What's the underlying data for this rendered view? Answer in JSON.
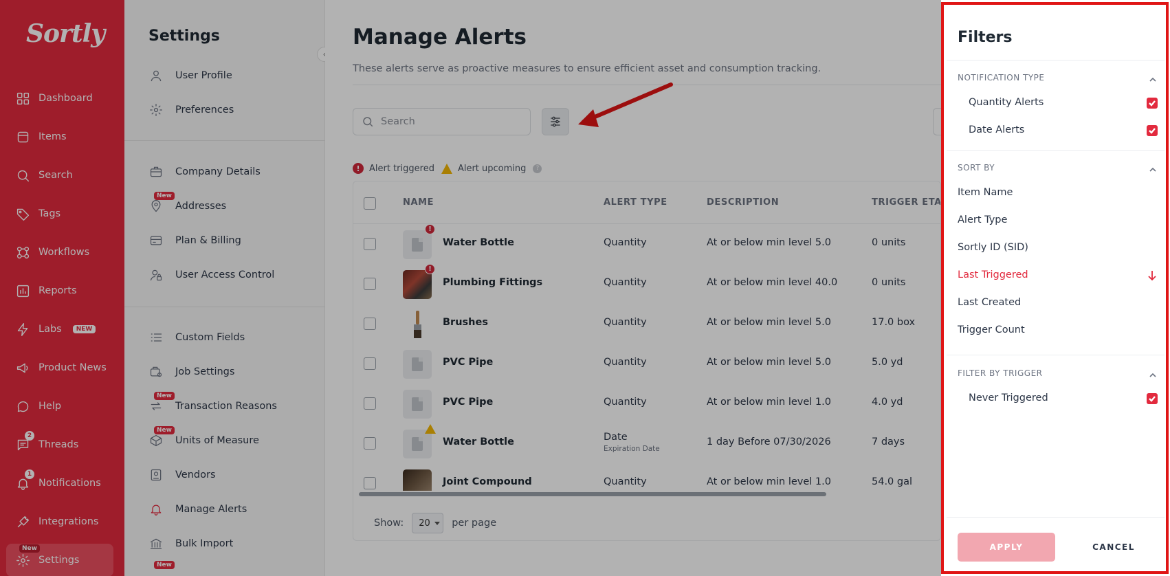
{
  "brand": {
    "logo_text": "Sortly",
    "accent_color": "#e22a3e"
  },
  "nav": {
    "items": [
      {
        "label": "Dashboard",
        "icon": "dashboard-icon"
      },
      {
        "label": "Items",
        "icon": "items-icon"
      },
      {
        "label": "Search",
        "icon": "search-icon"
      },
      {
        "label": "Tags",
        "icon": "tag-icon"
      },
      {
        "label": "Workflows",
        "icon": "workflows-icon"
      },
      {
        "label": "Reports",
        "icon": "reports-icon"
      },
      {
        "label": "Labs",
        "icon": "bolt-icon",
        "pill": "NEW"
      },
      {
        "label": "Product News",
        "icon": "megaphone-icon"
      },
      {
        "label": "Help",
        "icon": "help-icon"
      },
      {
        "label": "Threads",
        "icon": "chat-icon",
        "count": "2"
      },
      {
        "label": "Notifications",
        "icon": "bell-icon",
        "count": "1"
      },
      {
        "label": "Integrations",
        "icon": "plug-icon"
      },
      {
        "label": "Settings",
        "icon": "gear-icon",
        "tag": "New"
      }
    ]
  },
  "settings": {
    "title": "Settings",
    "new_tag": "New",
    "items": [
      {
        "label": "User Profile",
        "icon": "user-icon"
      },
      {
        "label": "Preferences",
        "icon": "gear-icon"
      },
      {
        "label": "Company Details",
        "icon": "briefcase-icon"
      },
      {
        "label": "Addresses",
        "icon": "map-pin-icon",
        "tag": "New"
      },
      {
        "label": "Plan & Billing",
        "icon": "credit-card-icon"
      },
      {
        "label": "User Access Control",
        "icon": "user-lock-icon"
      },
      {
        "label": "Custom Fields",
        "icon": "list-icon"
      },
      {
        "label": "Job Settings",
        "icon": "job-icon"
      },
      {
        "label": "Transaction Reasons",
        "icon": "exchange-icon",
        "tag": "New"
      },
      {
        "label": "Units of Measure",
        "icon": "box-icon",
        "tag": "New"
      },
      {
        "label": "Vendors",
        "icon": "vendor-icon"
      },
      {
        "label": "Manage Alerts",
        "icon": "bell-gear-icon"
      },
      {
        "label": "Bulk Import",
        "icon": "bank-icon"
      }
    ]
  },
  "main": {
    "title": "Manage Alerts",
    "subtitle": "These alerts serve as proactive measures to ensure efficient asset and consumption tracking.",
    "search_placeholder": "Search",
    "legend": {
      "triggered": "Alert triggered",
      "upcoming": "Alert upcoming",
      "triggered_glyph": "!",
      "help_glyph": "?"
    },
    "columns": [
      "NAME",
      "ALERT TYPE",
      "DESCRIPTION",
      "TRIGGER ETA"
    ],
    "rows": [
      {
        "name": "Water Bottle",
        "type": "Quantity",
        "type_sub": "",
        "desc": "At or below min level 5.0",
        "eta": "0 units",
        "alert": "triggered",
        "thumb": "placeholder"
      },
      {
        "name": "Plumbing Fittings",
        "type": "Quantity",
        "type_sub": "",
        "desc": "At or below min level 40.0",
        "eta": "0 units",
        "alert": "triggered",
        "thumb": "photo-pl"
      },
      {
        "name": "Brushes",
        "type": "Quantity",
        "type_sub": "",
        "desc": "At or below min level 5.0",
        "eta": "17.0 box",
        "alert": "",
        "thumb": "photo-br"
      },
      {
        "name": "PVC Pipe",
        "type": "Quantity",
        "type_sub": "",
        "desc": "At or below min level 5.0",
        "eta": "5.0 yd",
        "alert": "",
        "thumb": "placeholder"
      },
      {
        "name": "PVC Pipe",
        "type": "Quantity",
        "type_sub": "",
        "desc": "At or below min level 1.0",
        "eta": "4.0 yd",
        "alert": "",
        "thumb": "placeholder"
      },
      {
        "name": "Water Bottle",
        "type": "Date",
        "type_sub": "Expiration Date",
        "desc": "1 day Before 07/30/2026",
        "eta": "7 days",
        "alert": "upcoming",
        "thumb": "placeholder"
      },
      {
        "name": "Joint Compound",
        "type": "Quantity",
        "type_sub": "",
        "desc": "At or below min level 1.0",
        "eta": "54.0 gal",
        "alert": "",
        "thumb": "photo-jc"
      }
    ],
    "pagination": {
      "show_label": "Show:",
      "per_page_value": "20",
      "per_page_label": "per page"
    }
  },
  "filters": {
    "title": "Filters",
    "notification_type": {
      "heading": "NOTIFICATION TYPE",
      "options": [
        {
          "label": "Quantity Alerts",
          "checked": true
        },
        {
          "label": "Date Alerts",
          "checked": true
        }
      ]
    },
    "sort_by": {
      "heading": "SORT BY",
      "options": [
        "Item Name",
        "Alert Type",
        "Sortly ID (SID)",
        "Last Triggered",
        "Last Created",
        "Trigger Count"
      ],
      "active": "Last Triggered",
      "direction": "descending"
    },
    "filter_by_trigger": {
      "heading": "FILTER BY TRIGGER",
      "options": [
        {
          "label": "Never Triggered",
          "checked": true
        }
      ]
    },
    "apply_label": "APPLY",
    "cancel_label": "CANCEL"
  }
}
